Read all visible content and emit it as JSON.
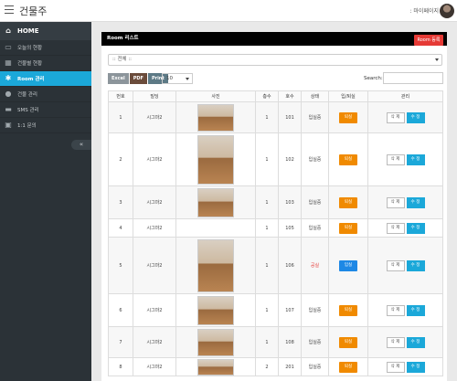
{
  "header": {
    "brand": "건물주",
    "user_label": ": 마이페이지"
  },
  "sidebar": {
    "home": "HOME",
    "items": [
      {
        "label": "오늘의 현황",
        "icon": "monitor-icon",
        "active": false
      },
      {
        "label": "건물별 현황",
        "icon": "table-icon",
        "active": false
      },
      {
        "label": "Room 관리",
        "icon": "gear-icon",
        "active": true
      },
      {
        "label": "건물 관리",
        "icon": "location-icon",
        "active": false
      },
      {
        "label": "SMS 관리",
        "icon": "message-icon",
        "active": false
      },
      {
        "label": "1:1 문의",
        "icon": "lock-icon",
        "active": false
      }
    ],
    "collapse": "«"
  },
  "panel": {
    "title": "Room 리스트",
    "register_button": "Room 등록",
    "filter_value": ":: 전체 ::",
    "tools": {
      "excel": "Excel",
      "pdf": "PDF",
      "print": "Print"
    },
    "page_size": "10",
    "search_label": "Search:",
    "search_value": ""
  },
  "table": {
    "columns": [
      "번호",
      "빌딩",
      "사진",
      "층수",
      "호수",
      "상태",
      "입/퇴실",
      "관리"
    ],
    "delete_label": "삭 제",
    "edit_label": "수 정",
    "rows": [
      {
        "no": "1",
        "building": "시그마2",
        "floor": "1",
        "room": "101",
        "status": "입실중",
        "action": "퇴실"
      },
      {
        "no": "2",
        "building": "시그마2",
        "floor": "1",
        "room": "102",
        "status": "입실중",
        "action": "퇴실"
      },
      {
        "no": "3",
        "building": "시그마2",
        "floor": "1",
        "room": "103",
        "status": "입실중",
        "action": "퇴실"
      },
      {
        "no": "4",
        "building": "시그마2",
        "floor": "1",
        "room": "105",
        "status": "입실중",
        "action": "퇴실"
      },
      {
        "no": "5",
        "building": "시그마2",
        "floor": "1",
        "room": "106",
        "status": "공실",
        "action": "입실"
      },
      {
        "no": "6",
        "building": "시그마2",
        "floor": "1",
        "room": "107",
        "status": "입실중",
        "action": "퇴실"
      },
      {
        "no": "7",
        "building": "시그마2",
        "floor": "1",
        "room": "108",
        "status": "입실중",
        "action": "퇴실"
      },
      {
        "no": "8",
        "building": "시그마2",
        "floor": "2",
        "room": "201",
        "status": "입실중",
        "action": "퇴실"
      }
    ]
  },
  "colors": {
    "accent": "#1ba8d9",
    "danger": "#e53935",
    "checkout": "#f08a00",
    "checkin": "#1e88e5"
  }
}
